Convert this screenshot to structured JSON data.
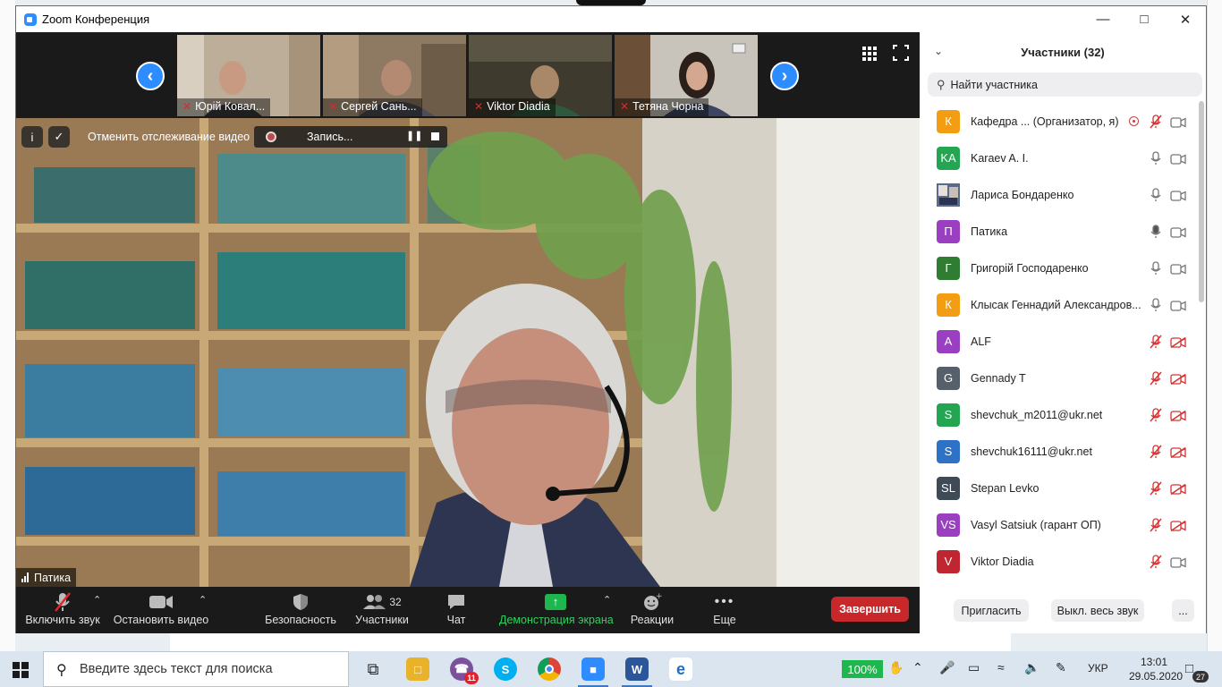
{
  "window": {
    "title": "Zoom Конференция"
  },
  "thumbnails": [
    {
      "name": "Юрій Ковал..."
    },
    {
      "name": "Сергей Сань..."
    },
    {
      "name": "Viktor Diadia"
    },
    {
      "name": "Тетяна Чорна"
    }
  ],
  "overlay": {
    "tracking_text": "Отменить отслеживание видео",
    "recording_text": "Запись..."
  },
  "speaker": {
    "name": "Патика"
  },
  "toolbar": {
    "unmute": "Включить звук",
    "stop_video": "Остановить видео",
    "security": "Безопасность",
    "participants": "Участники",
    "participants_count": "32",
    "chat": "Чат",
    "share": "Демонстрация экрана",
    "reactions": "Реакции",
    "more": "Еще",
    "end": "Завершить"
  },
  "panel": {
    "title": "Участники (32)",
    "search_placeholder": "Найти участника",
    "participants": [
      {
        "initials": "К",
        "name": "Кафедра ... (Организатор, я)",
        "color": "#f29d12",
        "mic": "muted",
        "cam": "on",
        "host": true
      },
      {
        "initials": "KA",
        "name": "Karaev A. I.",
        "color": "#23a551",
        "mic": "on",
        "cam": "on"
      },
      {
        "initials": "",
        "name": "Лариса Бондаренко",
        "color": "#3d4a6b",
        "mic": "on",
        "cam": "on",
        "photo": true
      },
      {
        "initials": "П",
        "name": "Патика",
        "color": "#9a3fc1",
        "mic": "active",
        "cam": "on"
      },
      {
        "initials": "Г",
        "name": "Григорій Господаренко",
        "color": "#2e7d32",
        "mic": "on",
        "cam": "on"
      },
      {
        "initials": "К",
        "name": "Клысак Геннадий Александров...",
        "color": "#f29d12",
        "mic": "on",
        "cam": "on"
      },
      {
        "initials": "A",
        "name": "ALF",
        "color": "#9a3fc1",
        "mic": "muted",
        "cam": "off"
      },
      {
        "initials": "G",
        "name": "Gennady T",
        "color": "#55606b",
        "mic": "muted",
        "cam": "off"
      },
      {
        "initials": "S",
        "name": "shevchuk_m2011@ukr.net",
        "color": "#23a551",
        "mic": "muted",
        "cam": "off"
      },
      {
        "initials": "S",
        "name": "shevchuk16111@ukr.net",
        "color": "#2d72c4",
        "mic": "muted",
        "cam": "off"
      },
      {
        "initials": "SL",
        "name": "Stepan Levko",
        "color": "#3f4a57",
        "mic": "muted",
        "cam": "off"
      },
      {
        "initials": "VS",
        "name": "Vasyl Satsiuk (гарант ОП)",
        "color": "#9a3fc1",
        "mic": "muted",
        "cam": "off"
      },
      {
        "initials": "V",
        "name": "Viktor Diadia",
        "color": "#c0262f",
        "mic": "muted",
        "cam": "on"
      }
    ],
    "invite": "Пригласить",
    "mute_all": "Выкл. весь звук",
    "more": "..."
  },
  "taskbar": {
    "search_placeholder": "Введите здесь текст для поиска",
    "viber_badge": "11",
    "zoom_percent": "100%",
    "language": "УКР",
    "time": "13:01",
    "date": "29.05.2020",
    "notifications": "27"
  }
}
